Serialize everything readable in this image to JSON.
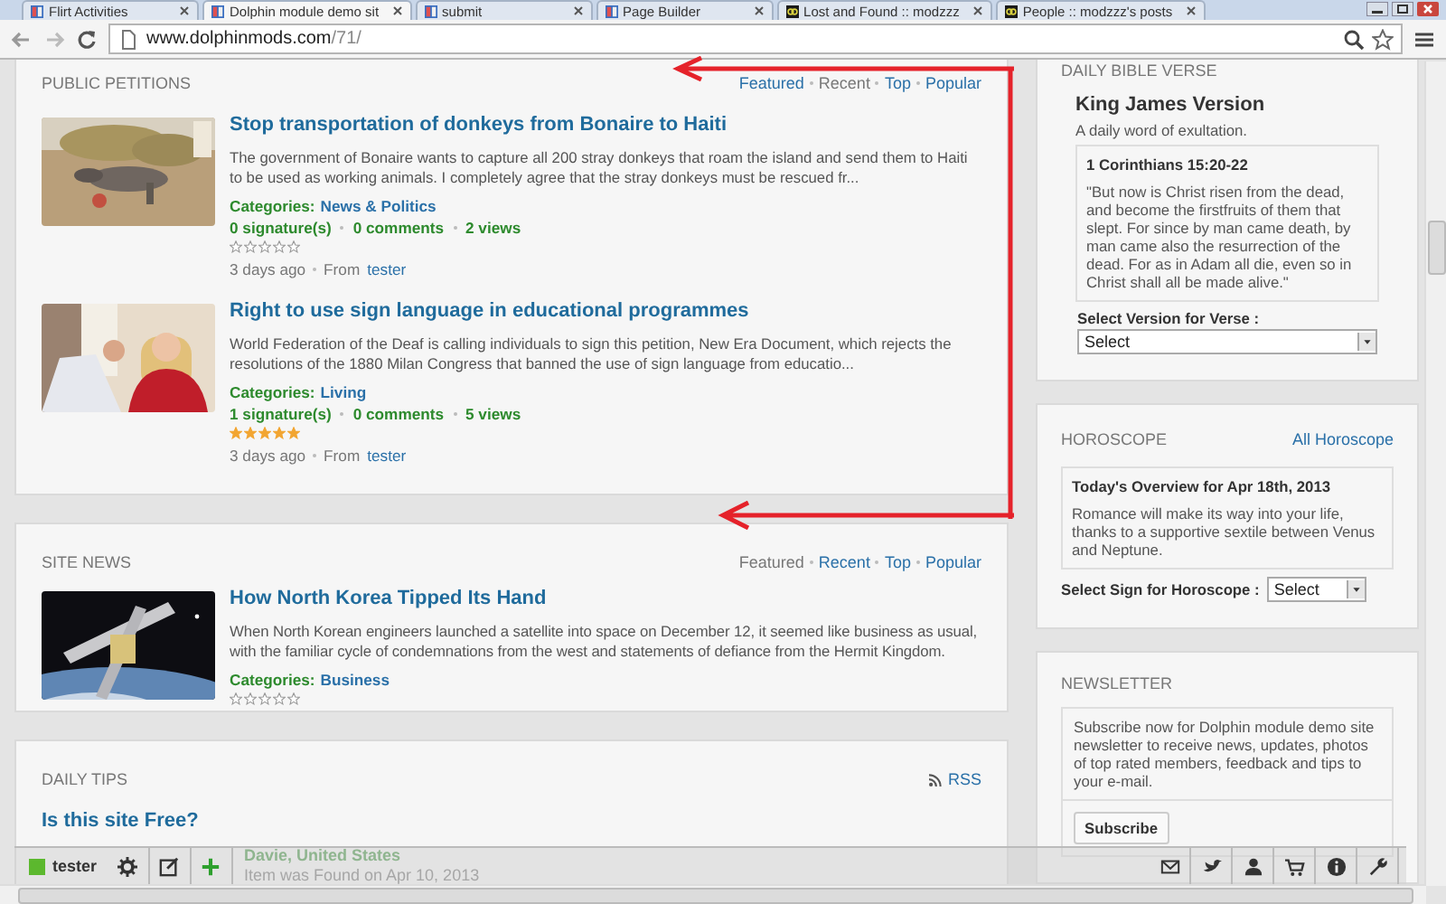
{
  "browser": {
    "tabs": [
      {
        "title": "Flirt Activities",
        "kind": "dolphin",
        "selected": false
      },
      {
        "title": "Dolphin module demo sit",
        "kind": "dolphin",
        "selected": true
      },
      {
        "title": "submit",
        "kind": "dolphin",
        "selected": false
      },
      {
        "title": "Page Builder",
        "kind": "dolphin",
        "selected": false
      },
      {
        "title": "Lost and Found :: modzzz",
        "kind": "dark",
        "selected": false
      },
      {
        "title": "People :: modzzz's posts",
        "kind": "dark",
        "selected": false
      }
    ],
    "address": {
      "host": "www.dolphinmods.com",
      "path": "/71/"
    }
  },
  "petitions": {
    "title": "PUBLIC PETITIONS",
    "links": [
      {
        "label": "Featured",
        "selected": false
      },
      {
        "label": "Recent",
        "selected": true
      },
      {
        "label": "Top",
        "selected": false
      },
      {
        "label": "Popular",
        "selected": false
      }
    ],
    "items": [
      {
        "title": "Stop transportation of donkeys from Bonaire to Haiti",
        "text": "The government of Bonaire wants to capture all 200 stray donkeys that roam the island and send them to Haiti to be used as working animals. I completely agree that the stray donkeys must be rescued fr...",
        "category_label": "Categories:",
        "category": "News & Politics",
        "stats": [
          "0 signature(s)",
          "0 comments",
          "2 views"
        ],
        "stars": 0,
        "time": "3 days ago",
        "from": "From",
        "author": "tester"
      },
      {
        "title": "Right to use sign language in educational programmes",
        "text": "World Federation of the Deaf is calling individuals to sign this petition, New Era Document, which rejects the resolutions of the 1880 Milan Congress that banned the use of sign language from educatio...",
        "category_label": "Categories:",
        "category": "Living",
        "stats": [
          "1 signature(s)",
          "0 comments",
          "5 views"
        ],
        "stars": 5,
        "time": "3 days ago",
        "from": "From",
        "author": "tester"
      }
    ]
  },
  "site_news": {
    "title": "SITE NEWS",
    "links": [
      {
        "label": "Featured",
        "selected": true
      },
      {
        "label": "Recent",
        "selected": false
      },
      {
        "label": "Top",
        "selected": false
      },
      {
        "label": "Popular",
        "selected": false
      }
    ],
    "items": [
      {
        "title": "How North Korea Tipped Its Hand",
        "text": "When North Korean engineers launched a satellite into space on December 12, it seemed like business as usual, with the familiar cycle of condemnations from the west and statements of defiance from the Hermit Kingdom.",
        "category_label": "Categories:",
        "category": "Business",
        "stars": 0
      }
    ]
  },
  "daily_tips": {
    "title": "DAILY TIPS",
    "rss": "RSS",
    "question": "Is this site Free?",
    "location": "Davie, United States",
    "found": "Item was Found on Apr 10, 2013"
  },
  "bible": {
    "title": "DAILY BIBLE VERSE",
    "version": "King James Version",
    "subtitle": "A daily word of exultation.",
    "reference": "1 Corinthians 15:20-22",
    "verse": "\"But now is Christ risen from the dead, and become the firstfruits of them that slept. For since by man came death, by man came also the resurrection of the dead. For as in Adam all die, even so in Christ shall all be made alive.\"",
    "select_label": "Select Version for Verse :",
    "select": "Select"
  },
  "horoscope": {
    "title": "HOROSCOPE",
    "link": "All Horoscope",
    "overview_title": "Today's Overview for Apr 18th, 2013",
    "text": "Romance will make its way into your life, thanks to a supportive sextile between Venus and Neptune.",
    "select_label": "Select Sign for Horoscope :",
    "select": "Select"
  },
  "newsletter": {
    "title": "NEWSLETTER",
    "text": "Subscribe now for Dolphin module demo site newsletter to receive news, updates, photos of top rated members, feedback and tips to your e-mail.",
    "button": "Subscribe"
  },
  "toolbar": {
    "user": "tester"
  }
}
